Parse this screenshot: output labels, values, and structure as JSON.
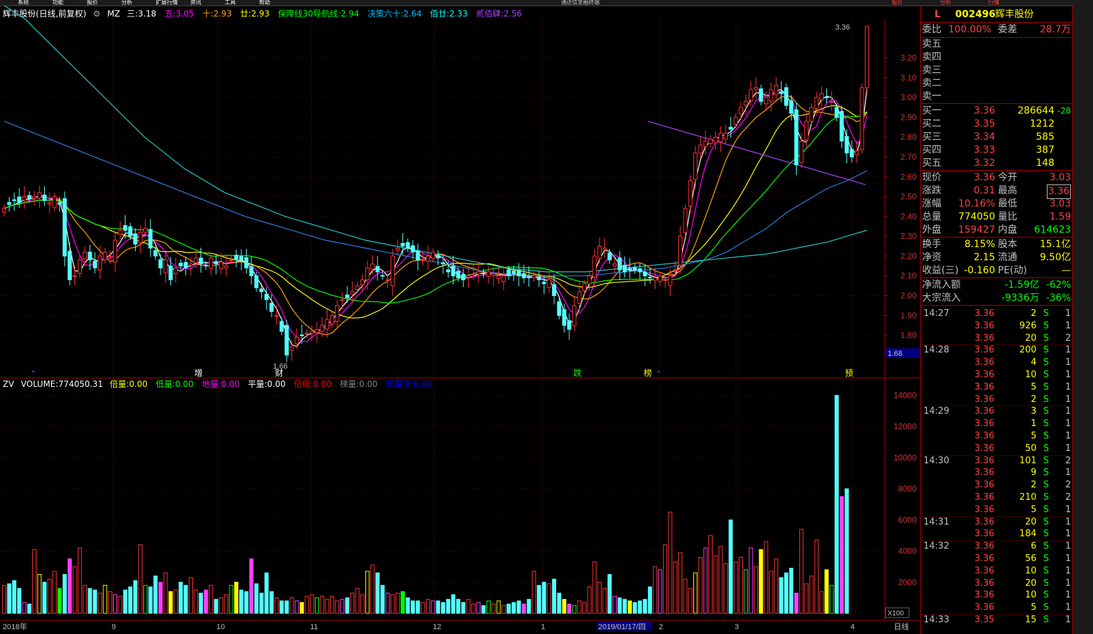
{
  "window": {
    "menu_labels": [
      "系统",
      "功能",
      "报价",
      "分析",
      "扩展行情",
      "资讯",
      "工具",
      "帮助"
    ],
    "title_center": "通达信金融终端",
    "right_tabs": [
      "报价",
      "分析",
      "行情"
    ]
  },
  "main_header": {
    "stock": "辉丰股份",
    "period": "(日线,前复权)",
    "indicator": "MZ",
    "items": [
      {
        "label": "三:",
        "value": "3.18",
        "color": "#ffffff"
      },
      {
        "label": "五:",
        "value": "3.05",
        "color": "#ff00ff"
      },
      {
        "label": "十:",
        "value": "2.93",
        "color": "#ffa500"
      },
      {
        "label": "廿:",
        "value": "2.93",
        "color": "#ffff00"
      },
      {
        "label": "保障线30导航线:",
        "value": "2.94",
        "color": "#00ff00"
      },
      {
        "label": "决策六十:",
        "value": "2.64",
        "color": "#00bfff"
      },
      {
        "label": "佰廿:",
        "value": "2.33",
        "color": "#00ffff"
      },
      {
        "label": "贰佰肆:",
        "value": "2.56",
        "color": "#b040ff"
      }
    ]
  },
  "price_axis": [
    "3.20",
    "3.10",
    "3.00",
    "2.90",
    "2.80",
    "2.70",
    "2.60",
    "2.50",
    "2.40",
    "2.30",
    "2.20",
    "2.10",
    "2.00",
    "1.90",
    "1.80"
  ],
  "current_price_tag": "1.68",
  "annotations": {
    "high": "3.36",
    "low": "1.66"
  },
  "event_markers": [
    {
      "text": "增",
      "color": "#ffffff"
    },
    {
      "text": "财",
      "color": "#ffffff"
    },
    {
      "text": "跌",
      "color": "#00ff00"
    },
    {
      "text": "榜",
      "color": "#ffff00"
    },
    {
      "text": "预",
      "color": "#ffff00"
    }
  ],
  "volume_header": {
    "name": "ZV",
    "volume_label": "VOLUME:",
    "volume_value": "774050.31",
    "items": [
      {
        "label": "倍量:",
        "value": "0.00",
        "color": "#ffff00"
      },
      {
        "label": "低量:",
        "value": "0.00",
        "color": "#00ff00"
      },
      {
        "label": "地量:",
        "value": "0.00",
        "color": "#ff00ff"
      },
      {
        "label": "平量:",
        "value": "0.00",
        "color": "#ffffff"
      },
      {
        "label": "倍缩:",
        "value": "0.00",
        "color": "#ff0000"
      },
      {
        "label": "梯量:",
        "value": "0.00",
        "color": "#808080"
      },
      {
        "label": "缩量涨:",
        "value": "0.00",
        "color": "#0000ff"
      }
    ]
  },
  "volume_axis": [
    "14000",
    "12000",
    "10000",
    "8000",
    "6000",
    "4000",
    "2000"
  ],
  "volume_unit": "X100",
  "date_axis": [
    "2018年",
    "9",
    "10",
    "11",
    "12",
    "1",
    "2019/01/17/四",
    "2",
    "3",
    "4"
  ],
  "period_button": "日线",
  "quote": {
    "code": "002496",
    "name": "辉丰股份",
    "flag": "L",
    "weibi_label": "委比",
    "weibi_value": "100.00%",
    "weicha_label": "委差",
    "weicha_value": "28.7万",
    "sell": [
      "卖五",
      "卖四",
      "卖三",
      "卖二",
      "卖一"
    ],
    "buy": [
      {
        "label": "买一",
        "price": "3.36",
        "vol": "286644",
        "chg": "-28"
      },
      {
        "label": "买二",
        "price": "3.35",
        "vol": "1212",
        "chg": ""
      },
      {
        "label": "买三",
        "price": "3.34",
        "vol": "585",
        "chg": ""
      },
      {
        "label": "买四",
        "price": "3.33",
        "vol": "387",
        "chg": ""
      },
      {
        "label": "买五",
        "price": "3.32",
        "vol": "148",
        "chg": ""
      }
    ],
    "stats": [
      {
        "l1": "现价",
        "v1": "3.36",
        "l2": "今开",
        "v2": "3.03",
        "c1": "#ff4040",
        "c2": "#ff4040"
      },
      {
        "l1": "涨跌",
        "v1": "0.31",
        "l2": "最高",
        "v2": "3.36",
        "c1": "#ff4040",
        "c2": "#ff4040"
      },
      {
        "l1": "涨幅",
        "v1": "10.16%",
        "l2": "最低",
        "v2": "3.03",
        "c1": "#ff4040",
        "c2": "#ff4040"
      },
      {
        "l1": "总量",
        "v1": "774050",
        "l2": "量比",
        "v2": "1.59",
        "c1": "#ffff00",
        "c2": "#ff4040"
      },
      {
        "l1": "外盘",
        "v1": "159427",
        "l2": "内盘",
        "v2": "614623",
        "c1": "#ff4040",
        "c2": "#00ff00"
      }
    ],
    "stats2": [
      {
        "l1": "换手",
        "v1": "8.15%",
        "l2": "股本",
        "v2": "15.1亿",
        "c1": "#ffff00",
        "c2": "#ffff00"
      },
      {
        "l1": "净资",
        "v1": "2.15",
        "l2": "流通",
        "v2": "9.50亿",
        "c1": "#ffff00",
        "c2": "#ffff00"
      },
      {
        "l1": "收益(三)",
        "v1": "-0.160",
        "l2": "PE(动)",
        "v2": "—",
        "c1": "#ffff00",
        "c2": "#ffff00"
      }
    ],
    "flow": [
      {
        "label": "净流入额",
        "value": "-1.59亿",
        "pct": "-62%"
      },
      {
        "label": "大宗流入",
        "value": "-9336万",
        "pct": "-36%"
      }
    ]
  },
  "ticks": [
    {
      "t": "14:27",
      "p": "3.36",
      "q": "2",
      "s": "S",
      "n": "1"
    },
    {
      "t": "",
      "p": "3.36",
      "q": "926",
      "s": "S",
      "n": "1"
    },
    {
      "t": "",
      "p": "3.36",
      "q": "20",
      "s": "S",
      "n": "2"
    },
    {
      "t": "14:28",
      "p": "3.36",
      "q": "200",
      "s": "S",
      "n": "1"
    },
    {
      "t": "",
      "p": "3.36",
      "q": "4",
      "s": "S",
      "n": "1"
    },
    {
      "t": "",
      "p": "3.36",
      "q": "10",
      "s": "S",
      "n": "1"
    },
    {
      "t": "",
      "p": "3.36",
      "q": "5",
      "s": "S",
      "n": "1"
    },
    {
      "t": "",
      "p": "3.36",
      "q": "2",
      "s": "S",
      "n": "1"
    },
    {
      "t": "14:29",
      "p": "3.36",
      "q": "3",
      "s": "S",
      "n": "1"
    },
    {
      "t": "",
      "p": "3.36",
      "q": "1",
      "s": "S",
      "n": "1"
    },
    {
      "t": "",
      "p": "3.36",
      "q": "5",
      "s": "S",
      "n": "1"
    },
    {
      "t": "",
      "p": "3.36",
      "q": "50",
      "s": "S",
      "n": "1"
    },
    {
      "t": "14:30",
      "p": "3.36",
      "q": "101",
      "s": "S",
      "n": "2"
    },
    {
      "t": "",
      "p": "3.36",
      "q": "9",
      "s": "S",
      "n": "1"
    },
    {
      "t": "",
      "p": "3.36",
      "q": "2",
      "s": "S",
      "n": "2"
    },
    {
      "t": "",
      "p": "3.36",
      "q": "210",
      "s": "S",
      "n": "2"
    },
    {
      "t": "",
      "p": "3.36",
      "q": "5",
      "s": "S",
      "n": "1"
    },
    {
      "t": "14:31",
      "p": "3.36",
      "q": "20",
      "s": "S",
      "n": "1"
    },
    {
      "t": "",
      "p": "3.36",
      "q": "184",
      "s": "S",
      "n": "1"
    },
    {
      "t": "14:32",
      "p": "3.36",
      "q": "6",
      "s": "S",
      "n": "1"
    },
    {
      "t": "",
      "p": "3.36",
      "q": "56",
      "s": "S",
      "n": "1"
    },
    {
      "t": "",
      "p": "3.36",
      "q": "10",
      "s": "S",
      "n": "1"
    },
    {
      "t": "",
      "p": "3.36",
      "q": "20",
      "s": "S",
      "n": "1"
    },
    {
      "t": "",
      "p": "3.36",
      "q": "10",
      "s": "S",
      "n": "1"
    },
    {
      "t": "",
      "p": "3.36",
      "q": "5",
      "s": "S",
      "n": "1"
    },
    {
      "t": "14:33",
      "p": "3.35",
      "q": "15",
      "s": "S",
      "n": "1"
    }
  ],
  "chart_data": {
    "type": "candlestick",
    "price_range": [
      1.63,
      3.36
    ],
    "volume_range": [
      0,
      14500
    ],
    "closes": [
      2.44,
      2.46,
      2.48,
      2.47,
      2.5,
      2.49,
      2.5,
      2.52,
      2.48,
      2.47,
      2.5,
      2.46,
      2.2,
      2.08,
      2.1,
      2.18,
      2.22,
      2.18,
      2.14,
      2.2,
      2.22,
      2.2,
      2.28,
      2.33,
      2.33,
      2.3,
      2.26,
      2.32,
      2.34,
      2.24,
      2.2,
      2.14,
      2.18,
      2.08,
      2.14,
      2.15,
      2.14,
      2.16,
      2.19,
      2.16,
      2.15,
      2.19,
      2.16,
      2.17,
      2.15,
      2.18,
      2.18,
      2.18,
      2.14,
      2.1,
      2.04,
      2.02,
      1.98,
      1.92,
      1.9,
      1.82,
      1.7,
      1.74,
      1.79,
      1.8,
      1.81,
      1.82,
      1.83,
      1.85,
      1.88,
      1.9,
      1.95,
      1.98,
      1.99,
      2.02,
      2.05,
      2.08,
      2.14,
      2.16,
      2.12,
      2.1,
      2.08,
      2.2,
      2.24,
      2.25,
      2.24,
      2.22,
      2.18,
      2.18,
      2.2,
      2.22,
      2.19,
      2.16,
      2.12,
      2.1,
      2.09,
      2.08,
      2.1,
      2.11,
      2.12,
      2.11,
      2.12,
      2.11,
      2.1,
      2.1,
      2.1,
      2.11,
      2.1,
      2.09,
      2.09,
      2.1,
      2.08,
      2.06,
      2.08,
      2.0,
      1.9,
      1.85,
      1.83,
      1.95,
      2.02,
      2.06,
      2.1,
      2.2,
      2.25,
      2.24,
      2.18,
      2.16,
      2.13,
      2.12,
      2.13,
      2.13,
      2.12,
      2.1,
      2.09,
      2.09,
      2.1,
      2.08,
      2.1,
      2.13,
      2.3,
      2.44,
      2.58,
      2.72,
      2.76,
      2.78,
      2.79,
      2.8,
      2.82,
      2.82,
      2.84,
      2.9,
      2.95,
      2.98,
      3.04,
      3.05,
      2.98,
      3.0,
      3.04,
      3.06,
      3.02,
      2.96,
      2.92,
      2.66,
      2.78,
      2.88,
      2.95,
      3.0,
      3.02,
      3.0,
      2.98,
      2.9,
      2.78,
      2.72,
      2.7,
      2.73,
      3.05,
      3.36
    ],
    "volumes": [
      1800,
      1900,
      2100,
      1600,
      700,
      600,
      4100,
      2500,
      2000,
      2200,
      2700,
      1600,
      2500,
      3500,
      3000,
      4200,
      1800,
      1600,
      1500,
      1300,
      1800,
      1400,
      1200,
      1100,
      1500,
      1700,
      2100,
      4400,
      1800,
      1700,
      2400,
      2000,
      2600,
      1400,
      1500,
      2000,
      1800,
      2300,
      1500,
      1300,
      1500,
      1800,
      900,
      1000,
      1200,
      1800,
      2000,
      1500,
      1400,
      3500,
      1900,
      1300,
      2600,
      1400,
      1000,
      800,
      800,
      1000,
      800,
      700,
      1100,
      1200,
      1000,
      1100,
      900,
      1100,
      800,
      900,
      1000,
      1300,
      1600,
      1200,
      2700,
      3100,
      2600,
      1800,
      1300,
      1200,
      1300,
      1400,
      1000,
      800,
      800,
      700,
      900,
      800,
      800,
      700,
      900,
      1200,
      900,
      700,
      900,
      600,
      700,
      500,
      800,
      600,
      800,
      500,
      600,
      700,
      800,
      600,
      900,
      2700,
      1800,
      2000,
      1900,
      2200,
      1300,
      900,
      600,
      500,
      800,
      700,
      1700,
      3300,
      2000,
      1600,
      2500,
      1100,
      1000,
      900,
      800,
      700,
      800,
      900,
      1700,
      3000,
      2800,
      4400,
      6500,
      3300,
      3900,
      2200,
      1600,
      2600,
      3600,
      4200,
      5000,
      3700,
      4300,
      3200,
      6000,
      3300,
      3600,
      2800,
      4200,
      3000,
      4100,
      4600,
      2700,
      3500,
      2300,
      2600,
      2900,
      1300,
      5400,
      1900,
      2400,
      4700,
      1400,
      2800,
      1800,
      14000,
      7500,
      8000
    ]
  }
}
